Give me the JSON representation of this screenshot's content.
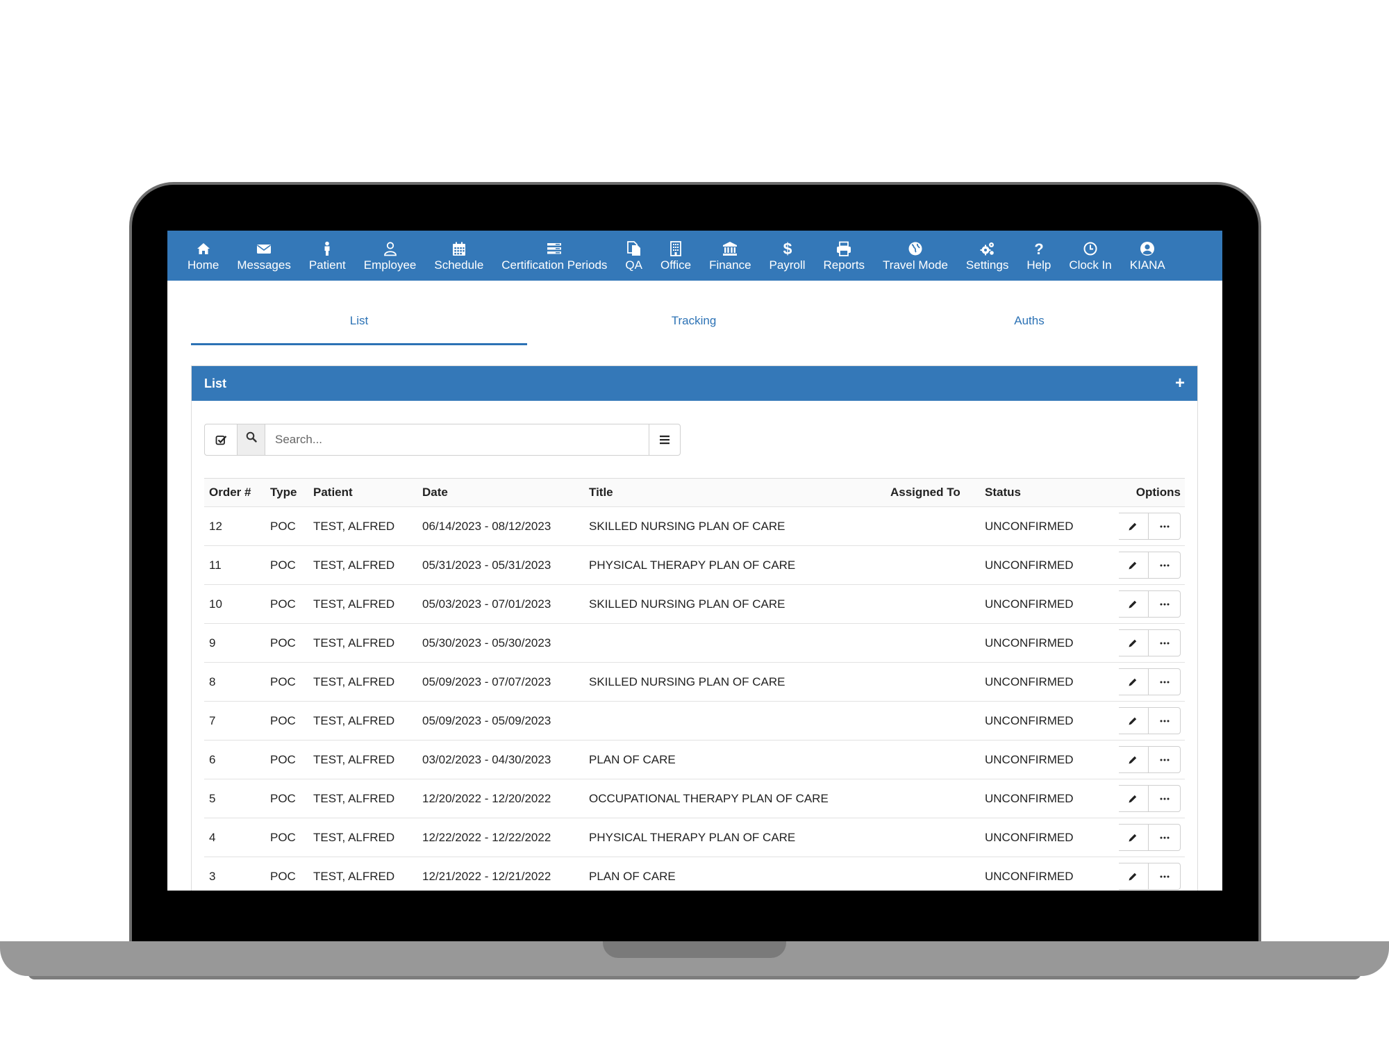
{
  "nav": [
    {
      "label": "Home",
      "icon": "home-icon"
    },
    {
      "label": "Messages",
      "icon": "envelope-icon"
    },
    {
      "label": "Patient",
      "icon": "person-icon"
    },
    {
      "label": "Employee",
      "icon": "user-outline-icon"
    },
    {
      "label": "Schedule",
      "icon": "calendar-icon"
    },
    {
      "label": "Certification Periods",
      "icon": "list-icon"
    },
    {
      "label": "QA",
      "icon": "documents-icon"
    },
    {
      "label": "Office",
      "icon": "building-icon"
    },
    {
      "label": "Finance",
      "icon": "bank-icon"
    },
    {
      "label": "Payroll",
      "icon": "dollar-icon"
    },
    {
      "label": "Reports",
      "icon": "printer-icon"
    },
    {
      "label": "Travel Mode",
      "icon": "globe-icon"
    },
    {
      "label": "Settings",
      "icon": "gears-icon"
    },
    {
      "label": "Help",
      "icon": "question-icon"
    },
    {
      "label": "Clock In",
      "icon": "clock-icon"
    },
    {
      "label": "KIANA",
      "icon": "user-circle-icon"
    }
  ],
  "tabs": [
    {
      "label": "List",
      "active": true
    },
    {
      "label": "Tracking",
      "active": false
    },
    {
      "label": "Auths",
      "active": false
    }
  ],
  "panel": {
    "title": "List",
    "add_label": "+"
  },
  "search": {
    "placeholder": "Search..."
  },
  "table": {
    "headers": {
      "order": "Order #",
      "type": "Type",
      "patient": "Patient",
      "date": "Date",
      "title": "Title",
      "assigned": "Assigned To",
      "status": "Status",
      "options": "Options"
    },
    "rows": [
      {
        "order": "12",
        "type": "POC",
        "patient": "TEST, ALFRED",
        "date": "06/14/2023 - 08/12/2023",
        "title": "SKILLED NURSING PLAN OF CARE",
        "assigned": "",
        "status": "UNCONFIRMED"
      },
      {
        "order": "11",
        "type": "POC",
        "patient": "TEST, ALFRED",
        "date": "05/31/2023 - 05/31/2023",
        "title": "PHYSICAL THERAPY PLAN OF CARE",
        "assigned": "",
        "status": "UNCONFIRMED"
      },
      {
        "order": "10",
        "type": "POC",
        "patient": "TEST, ALFRED",
        "date": "05/03/2023 - 07/01/2023",
        "title": "SKILLED NURSING PLAN OF CARE",
        "assigned": "",
        "status": "UNCONFIRMED"
      },
      {
        "order": "9",
        "type": "POC",
        "patient": "TEST, ALFRED",
        "date": "05/30/2023 - 05/30/2023",
        "title": "",
        "assigned": "",
        "status": "UNCONFIRMED"
      },
      {
        "order": "8",
        "type": "POC",
        "patient": "TEST, ALFRED",
        "date": "05/09/2023 - 07/07/2023",
        "title": "SKILLED NURSING PLAN OF CARE",
        "assigned": "",
        "status": "UNCONFIRMED"
      },
      {
        "order": "7",
        "type": "POC",
        "patient": "TEST, ALFRED",
        "date": "05/09/2023 - 05/09/2023",
        "title": "",
        "assigned": "",
        "status": "UNCONFIRMED"
      },
      {
        "order": "6",
        "type": "POC",
        "patient": "TEST, ALFRED",
        "date": "03/02/2023 - 04/30/2023",
        "title": "PLAN OF CARE",
        "assigned": "",
        "status": "UNCONFIRMED"
      },
      {
        "order": "5",
        "type": "POC",
        "patient": "TEST, ALFRED",
        "date": "12/20/2022 - 12/20/2022",
        "title": "OCCUPATIONAL THERAPY PLAN OF CARE",
        "assigned": "",
        "status": "UNCONFIRMED"
      },
      {
        "order": "4",
        "type": "POC",
        "patient": "TEST, ALFRED",
        "date": "12/22/2022 - 12/22/2022",
        "title": "PHYSICAL THERAPY PLAN OF CARE",
        "assigned": "",
        "status": "UNCONFIRMED"
      },
      {
        "order": "3",
        "type": "POC",
        "patient": "TEST, ALFRED",
        "date": "12/21/2022 - 12/21/2022",
        "title": "PLAN OF CARE",
        "assigned": "",
        "status": "UNCONFIRMED"
      }
    ]
  },
  "colors": {
    "brand": "#3478b8",
    "tab_text": "#2c72b5"
  }
}
